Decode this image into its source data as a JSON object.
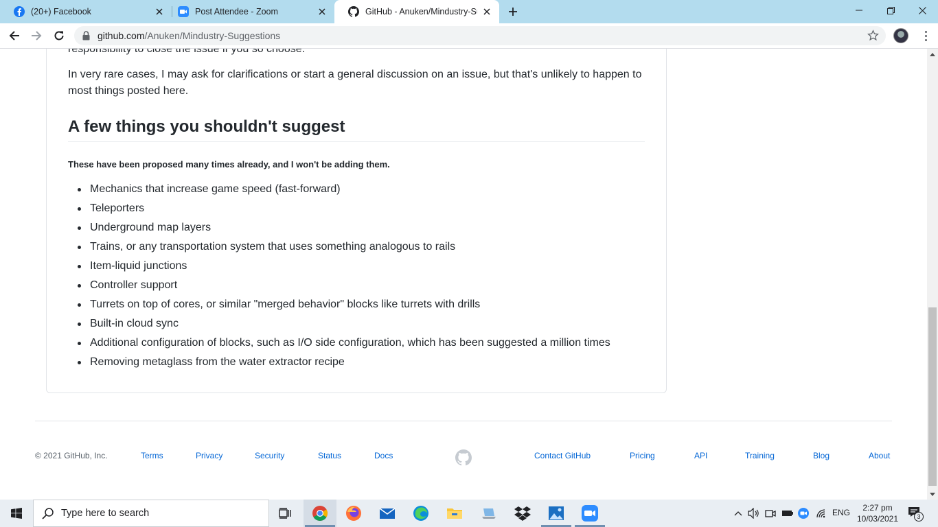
{
  "browser": {
    "tabs": [
      {
        "title": "(20+) Facebook",
        "icon": "facebook-icon",
        "active": false
      },
      {
        "title": "Post Attendee - Zoom",
        "icon": "zoom-icon",
        "active": false
      },
      {
        "title": "GitHub - Anuken/Mindustry-Sugg",
        "icon": "github-icon",
        "active": true
      }
    ],
    "url_host": "github.com",
    "url_path": "/Anuken/Mindustry-Suggestions"
  },
  "readme": {
    "cut_line": "responsibility to close the issue if you so choose.",
    "paragraph": "In very rare cases, I may ask for clarifications or start a general discussion on an issue, but that's unlikely to happen to most things posted here.",
    "heading": "A few things you shouldn't suggest",
    "bold_note": "These have been proposed many times already, and I won't be adding them.",
    "items": [
      "Mechanics that increase game speed (fast-forward)",
      "Teleporters",
      "Underground map layers",
      "Trains, or any transportation system that uses something analogous to rails",
      "Item-liquid junctions",
      "Controller support",
      "Turrets on top of cores, or similar \"merged behavior\" blocks like turrets with drills",
      "Built-in cloud sync",
      "Additional configuration of blocks, such as I/O side configuration, which has been suggested a million times",
      "Removing metaglass from the water extractor recipe"
    ]
  },
  "footer": {
    "copyright": "© 2021 GitHub, Inc.",
    "left_links": [
      "Terms",
      "Privacy",
      "Security",
      "Status",
      "Docs"
    ],
    "right_links": [
      "Contact GitHub",
      "Pricing",
      "API",
      "Training",
      "Blog",
      "About"
    ]
  },
  "taskbar": {
    "search_placeholder": "Type here to search",
    "language": "ENG",
    "time": "2:27 pm",
    "date": "10/03/2021",
    "notification_count": "3"
  },
  "colors": {
    "tab_strip": "#b3dcee",
    "link": "#0366d6",
    "text": "#24292e",
    "taskbar": "#e9eef3"
  }
}
